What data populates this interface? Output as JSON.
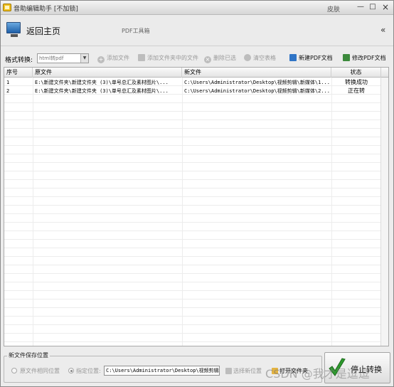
{
  "window": {
    "title": "音助编辑助手 [不加锁]",
    "skin_label": "皮肤",
    "min_glyph": "—",
    "max_glyph": "□",
    "close_glyph": "×"
  },
  "header": {
    "home_label": "返回主页",
    "subtitle": "PDF工具箱",
    "collapse_glyph": "«"
  },
  "toolbar": {
    "format_label": "格式转换:",
    "format_value": "html转pdf",
    "add_file": "添加文件",
    "add_folder_files": "添加文件夹中的文件",
    "delete_selected": "删除已选",
    "clear_table": "清空表格",
    "new_pdf": "新建PDF文档",
    "edit_pdf": "修改PDF文档"
  },
  "table": {
    "columns": [
      "序号",
      "原文件",
      "新文件",
      "状态"
    ],
    "rows": [
      {
        "seq": "1",
        "src": "E:\\新建文件夹\\新建文件夹 (3)\\单号总汇及素材图片\\...",
        "dst": "C:\\Users\\Administrator\\Desktop\\视频剪辑\\新媒体\\1...",
        "status": "转换成功"
      },
      {
        "seq": "2",
        "src": "E:\\新建文件夹\\新建文件夹 (3)\\单号总汇及素材图片\\...",
        "dst": "C:\\Users\\Administrator\\Desktop\\视频剪辑\\新媒体\\2...",
        "status": "正在转"
      }
    ]
  },
  "save": {
    "legend": "新文件保存位置",
    "same_location": "原文件相同位置",
    "specified_location": "指定位置:",
    "path": "C:\\Users\\Administrator\\Desktop\\视频剪辑\\新",
    "choose_location": "选择新位置",
    "open_folder": "打开文件夹"
  },
  "stop_button": "停止转换",
  "watermark": "CSDN @我才是逗逗"
}
